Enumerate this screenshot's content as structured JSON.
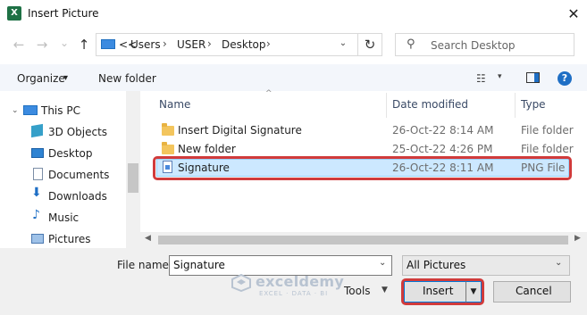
{
  "window": {
    "title": "Insert Picture",
    "app_icon": "excel-icon",
    "close_glyph": "✕"
  },
  "nav": {
    "back": "←",
    "forward": "→",
    "recent": "⌄",
    "up": "↑",
    "breadcrumb": [
      "<<",
      "Users",
      "USER",
      "Desktop"
    ],
    "separator": "›",
    "refresh": "↻",
    "search_placeholder": "Search Desktop"
  },
  "toolbar": {
    "organize": "Organize",
    "organize_caret": "▾",
    "new_folder": "New folder",
    "view_caret": "▾",
    "help": "?"
  },
  "sidebar": {
    "items": [
      {
        "label": "This PC",
        "icon": "computer-icon",
        "top": 0
      },
      {
        "label": "3D Objects",
        "icon": "cube-icon"
      },
      {
        "label": "Desktop",
        "icon": "desktop-icon"
      },
      {
        "label": "Documents",
        "icon": "documents-icon"
      },
      {
        "label": "Downloads",
        "icon": "download-icon"
      },
      {
        "label": "Music",
        "icon": "music-icon"
      },
      {
        "label": "Pictures",
        "icon": "pictures-icon"
      }
    ]
  },
  "columns": {
    "name": "Name",
    "date": "Date modified",
    "type": "Type"
  },
  "files": [
    {
      "name": "Insert Digital Signature",
      "date": "26-Oct-22 8:14 AM",
      "type": "File folder",
      "kind": "folder"
    },
    {
      "name": "New folder",
      "date": "25-Oct-22 4:26 PM",
      "type": "File folder",
      "kind": "folder"
    },
    {
      "name": "Signature",
      "date": "26-Oct-22 8:11 AM",
      "type": "PNG File",
      "kind": "png",
      "selected": true
    }
  ],
  "bottom": {
    "file_name_label": "File name:",
    "file_name_value": "Signature",
    "file_type": "All Pictures",
    "tools": "Tools",
    "insert": "Insert",
    "cancel": "Cancel"
  },
  "watermark": {
    "name": "exceldemy",
    "tagline": "EXCEL · DATA · BI"
  },
  "colors": {
    "selection": "#cce8ff",
    "highlight": "#d13b3b",
    "accent": "#0078d7"
  }
}
